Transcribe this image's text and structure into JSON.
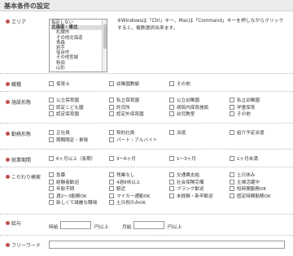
{
  "title": "基本条件の設定",
  "area": {
    "label": "エリア",
    "options": [
      {
        "text": "指定しない",
        "bold": false,
        "indent": false,
        "selected": false
      },
      {
        "text": "北海道・東北",
        "bold": true,
        "indent": false,
        "selected": true
      },
      {
        "text": "札幌市",
        "bold": false,
        "indent": true,
        "selected": false
      },
      {
        "text": "その他北海道",
        "bold": false,
        "indent": true,
        "selected": false
      },
      {
        "text": "青森",
        "bold": false,
        "indent": true,
        "selected": false
      },
      {
        "text": "岩手",
        "bold": false,
        "indent": true,
        "selected": false
      },
      {
        "text": "仙台市",
        "bold": false,
        "indent": true,
        "selected": false
      },
      {
        "text": "その他宮城",
        "bold": false,
        "indent": true,
        "selected": false
      },
      {
        "text": "秋田",
        "bold": false,
        "indent": true,
        "selected": false
      },
      {
        "text": "山形",
        "bold": false,
        "indent": true,
        "selected": false
      }
    ],
    "note": "※Windowsは「Ctrl」キー、Macは「Command」キーを押しながらクリックすると、複数選択出来ます。"
  },
  "occupation": {
    "label": "職種",
    "options": [
      "保育士",
      "幼稚園教諭",
      "その他"
    ]
  },
  "facility": {
    "label": "施設形態",
    "options": [
      "公立保育園",
      "私立保育園",
      "公立幼稚園",
      "私立幼稚園",
      "認定こども園",
      "託児所",
      "病院内保育施設",
      "学童保育",
      "認定保育園",
      "認定外保育園",
      "幼児教室",
      "その他"
    ]
  },
  "employment": {
    "label": "勤務形態",
    "options": [
      "正社員",
      "契約社員",
      "派遣",
      "紹介予定派遣",
      "期間限定・単発",
      "パート・アルバイト"
    ]
  },
  "period": {
    "label": "就業期間",
    "options": [
      "6ヶ月以上（長期）",
      "3〜6ヶ月",
      "1〜3ヶ月",
      "1ヶ月未満"
    ]
  },
  "preferences": {
    "label": "こだわり検索",
    "options": [
      "急募",
      "残業なし",
      "交通費支給",
      "土日休み",
      "経験者歓迎",
      "4週8休以上",
      "社会保険完備",
      "主婦活躍中",
      "年齢不問",
      "駅近",
      "ブランク歓迎",
      "短時間勤務OK",
      "週2〜3勤務OK",
      "マイカー通勤OK",
      "未経験・新卒歓迎",
      "固定時間勤務OK",
      "新しくて綺麗な職場",
      "土日祝のみOK"
    ]
  },
  "salary": {
    "label": "給与",
    "hourly_label": "時給",
    "monthly_label": "月給",
    "unit": "円以上",
    "hourly_value": "",
    "monthly_value": ""
  },
  "freeword": {
    "label": "フリーワード",
    "value": ""
  },
  "colors": {
    "accent_dot": "#c0504d",
    "title_bg": "#ececec"
  }
}
